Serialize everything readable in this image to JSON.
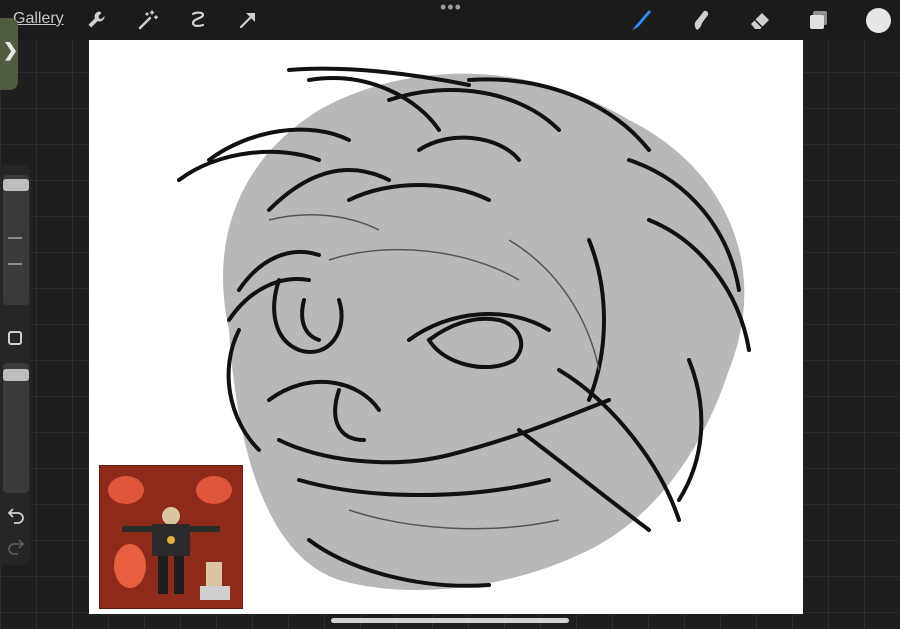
{
  "topbar": {
    "gallery_label": "Gallery",
    "left_tools": [
      "wrench-icon",
      "magic-wand-icon",
      "selection-icon",
      "transform-arrow-icon"
    ],
    "right_tools": [
      "brush-icon",
      "smudge-icon",
      "eraser-icon",
      "layers-icon"
    ],
    "more_label": "•••"
  },
  "colors": {
    "accent_blue": "#2f8cff",
    "current_color": "#e6e6e6",
    "handle_green": "#505c3e",
    "canvas": "#ffffff",
    "background": "#1f1f1f"
  },
  "sidebar": {
    "controls": [
      "brush-size-slider",
      "modify-button",
      "opacity-slider",
      "undo-icon",
      "redo-icon"
    ]
  },
  "side_handle": {
    "glyph": "❯"
  }
}
